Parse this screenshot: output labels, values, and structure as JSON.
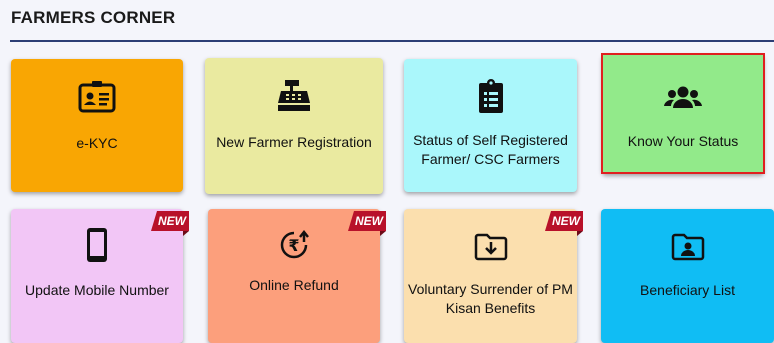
{
  "section": {
    "title": "FARMERS CORNER"
  },
  "cards": [
    {
      "label": "e-KYC",
      "icon": "id-card-icon",
      "color": "#f9a603"
    },
    {
      "label": "New Farmer Registration",
      "icon": "cash-register-icon",
      "color": "#eaeaa0"
    },
    {
      "label": "Status of Self Registered Farmer/ CSC Farmers",
      "icon": "clipboard-list-icon",
      "color": "#aaf7fb"
    },
    {
      "label": "Know Your Status",
      "icon": "users-icon",
      "color": "#92ea8a",
      "selected": true
    },
    {
      "label": "Update Mobile Number",
      "icon": "mobile-icon",
      "color": "#f2c6f6",
      "badge": "NEW"
    },
    {
      "label": "Online Refund",
      "icon": "rupee-refund-icon",
      "color": "#fc9f7c",
      "badge": "NEW"
    },
    {
      "label": "Voluntary Surrender of PM Kisan Benefits",
      "icon": "folder-download-icon",
      "color": "#fbdfae",
      "badge": "NEW"
    },
    {
      "label": "Beneficiary List",
      "icon": "folder-user-icon",
      "color": "#10bdf4"
    }
  ]
}
